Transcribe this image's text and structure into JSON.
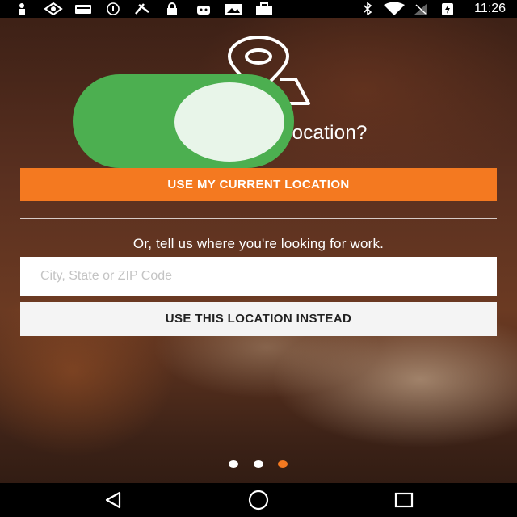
{
  "status_bar": {
    "time": "11:26",
    "icons": [
      "person-icon",
      "eye-icon",
      "card-icon",
      "info-icon",
      "satellite-icon",
      "lock-icon",
      "android-icon",
      "photo-icon",
      "bag-icon",
      "bluetooth-icon",
      "wifi-icon",
      "no-signal-icon",
      "battery-charging-icon"
    ]
  },
  "main": {
    "title_visible": "t location?",
    "toggle_state": "on",
    "current_location_button": "USE MY CURRENT LOCATION",
    "or_text": "Or, tell us where you're looking for work.",
    "location_input": {
      "value": "",
      "placeholder": "City, State or ZIP Code"
    },
    "use_location_button": "USE THIS LOCATION INSTEAD"
  },
  "pager": {
    "count": 3,
    "active_index": 2
  },
  "colors": {
    "accent": "#f47920",
    "toggle": "#4caf50",
    "toggle_knob": "#e8f5e9"
  },
  "nav_bar": {
    "buttons": [
      "back-icon",
      "home-icon",
      "recents-icon"
    ]
  }
}
